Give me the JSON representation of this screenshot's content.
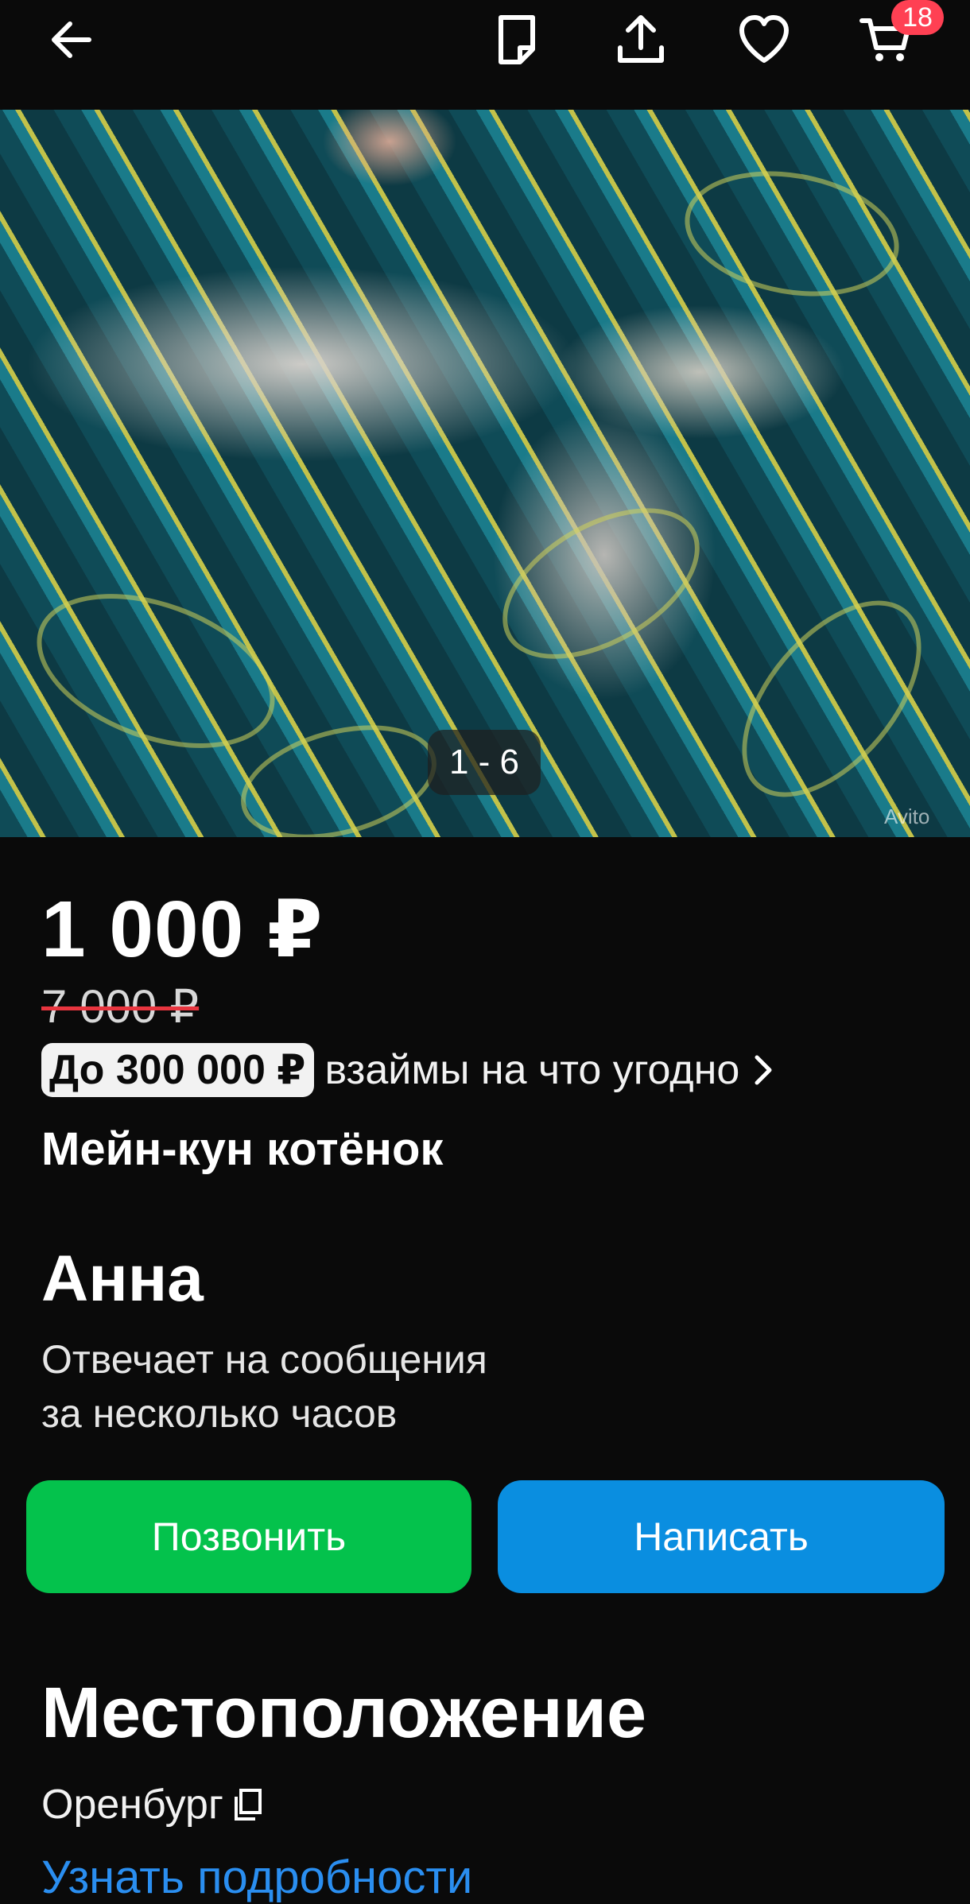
{
  "header": {
    "back_icon": "arrow-left-icon",
    "notes_icon": "note-icon",
    "share_icon": "share-upload-icon",
    "favorite_icon": "heart-icon",
    "cart_icon": "cart-icon",
    "cart_count": "18"
  },
  "gallery": {
    "counter": "1 - 6",
    "watermark": "Avito"
  },
  "listing": {
    "price": "1 000 ₽",
    "old_price": "7 000 ₽",
    "loan_badge": "До 300 000 ₽",
    "loan_text": "взаймы на что угодно",
    "title": "Мейн-кун котёнок"
  },
  "seller": {
    "name": "Анна",
    "reply_line1": "Отвечает на сообщения",
    "reply_line2": "за несколько часов"
  },
  "actions": {
    "call_label": "Позвонить",
    "write_label": "Написать"
  },
  "location": {
    "heading": "Местоположение",
    "city": "Оренбург",
    "details_link": "Узнать подробности"
  },
  "colors": {
    "call_button": "#04c24c",
    "write_button": "#0a8ee0",
    "badge": "#ff4053",
    "link": "#2a8ef0"
  }
}
